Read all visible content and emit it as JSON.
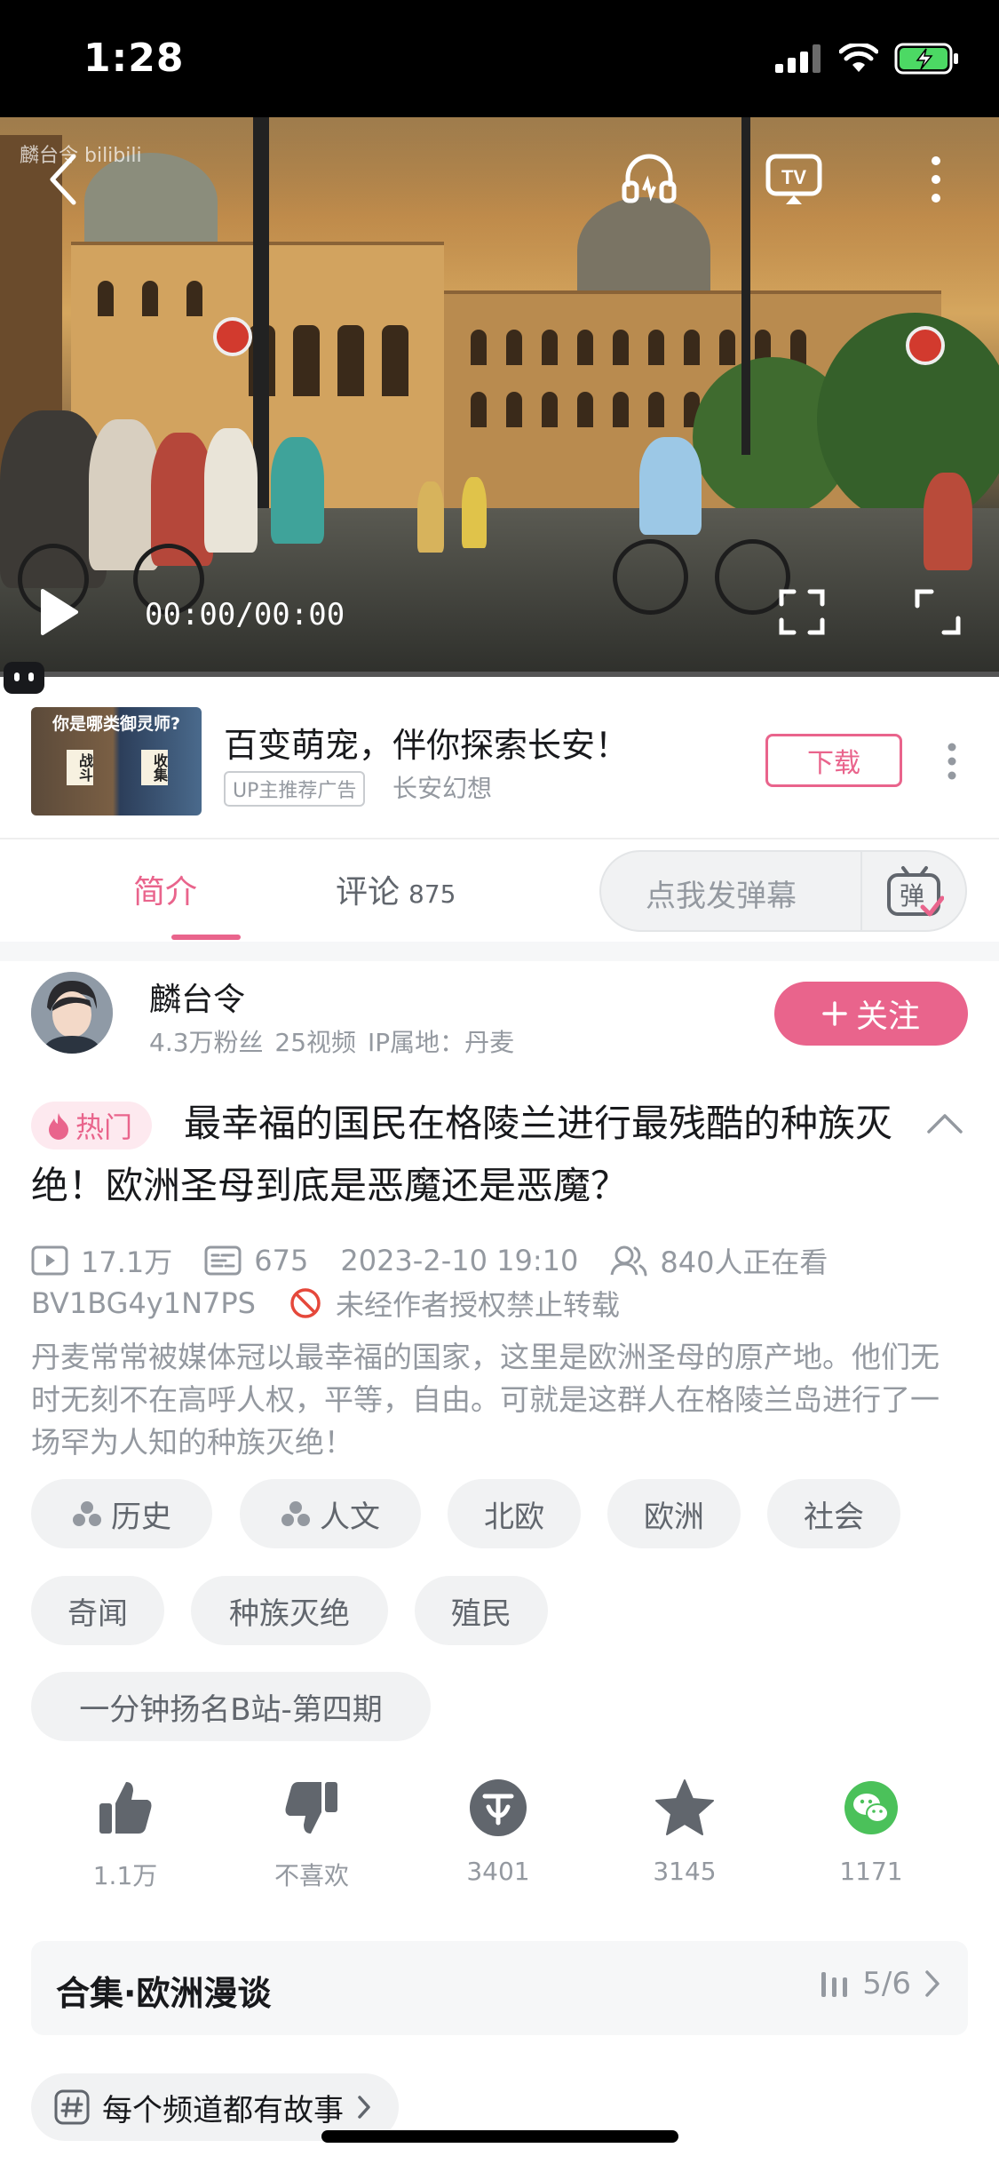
{
  "status_bar": {
    "time": "1:28"
  },
  "player": {
    "watermark": "麟台令 bilibili",
    "time_display": "00:00/00:00"
  },
  "ad": {
    "thumb_title": "你是哪类御灵师?",
    "thumb_left": "战斗",
    "thumb_right": "收集",
    "title": "百变萌宠，伴你探索长安！",
    "tag": "UP主推荐广告",
    "source": "长安幻想",
    "download_label": "下载"
  },
  "tabs": {
    "intro": "简介",
    "comments": "评论",
    "comments_count": "875",
    "danmaku_placeholder": "点我发弹幕",
    "danmaku_button": "弹"
  },
  "uploader": {
    "name": "麟台令",
    "stats": "4.3万粉丝  25视频  IP属地：丹麦",
    "follow_label": "关注"
  },
  "video": {
    "hot_badge": "热门",
    "title": "最幸福的国民在格陵兰进行最残酷的种族灭绝！欧洲圣母到底是恶魔还是恶魔？",
    "views": "17.1万",
    "danmaku_count": "675",
    "date": "2023-2-10 19:10",
    "watching": "840人正在看",
    "bvid": "BV1BG4y1N7PS",
    "reprint_notice": "未经作者授权禁止转载",
    "description": "丹麦常常被媒体冠以最幸福的国家，这里是欧洲圣母的原产地。他们无时无刻不在高呼人权，平等，自由。可就是这群人在格陵兰岛进行了一场罕为人知的种族灭绝！"
  },
  "tags": [
    "历史",
    "人文",
    "北欧",
    "欧洲",
    "社会",
    "奇闻",
    "种族灭绝",
    "殖民",
    "一分钟扬名B站-第四期"
  ],
  "actions": {
    "like": "1.1万",
    "dislike": "不喜欢",
    "coin": "3401",
    "favorite": "3145",
    "share": "1171"
  },
  "collection": {
    "title": "合集·欧洲漫谈",
    "progress": "5/6"
  },
  "channel_link": "每个频道都有故事",
  "colors": {
    "accent": "#e9648c",
    "secondary_text": "#9499a0",
    "wechat_green": "#4bc15a"
  }
}
